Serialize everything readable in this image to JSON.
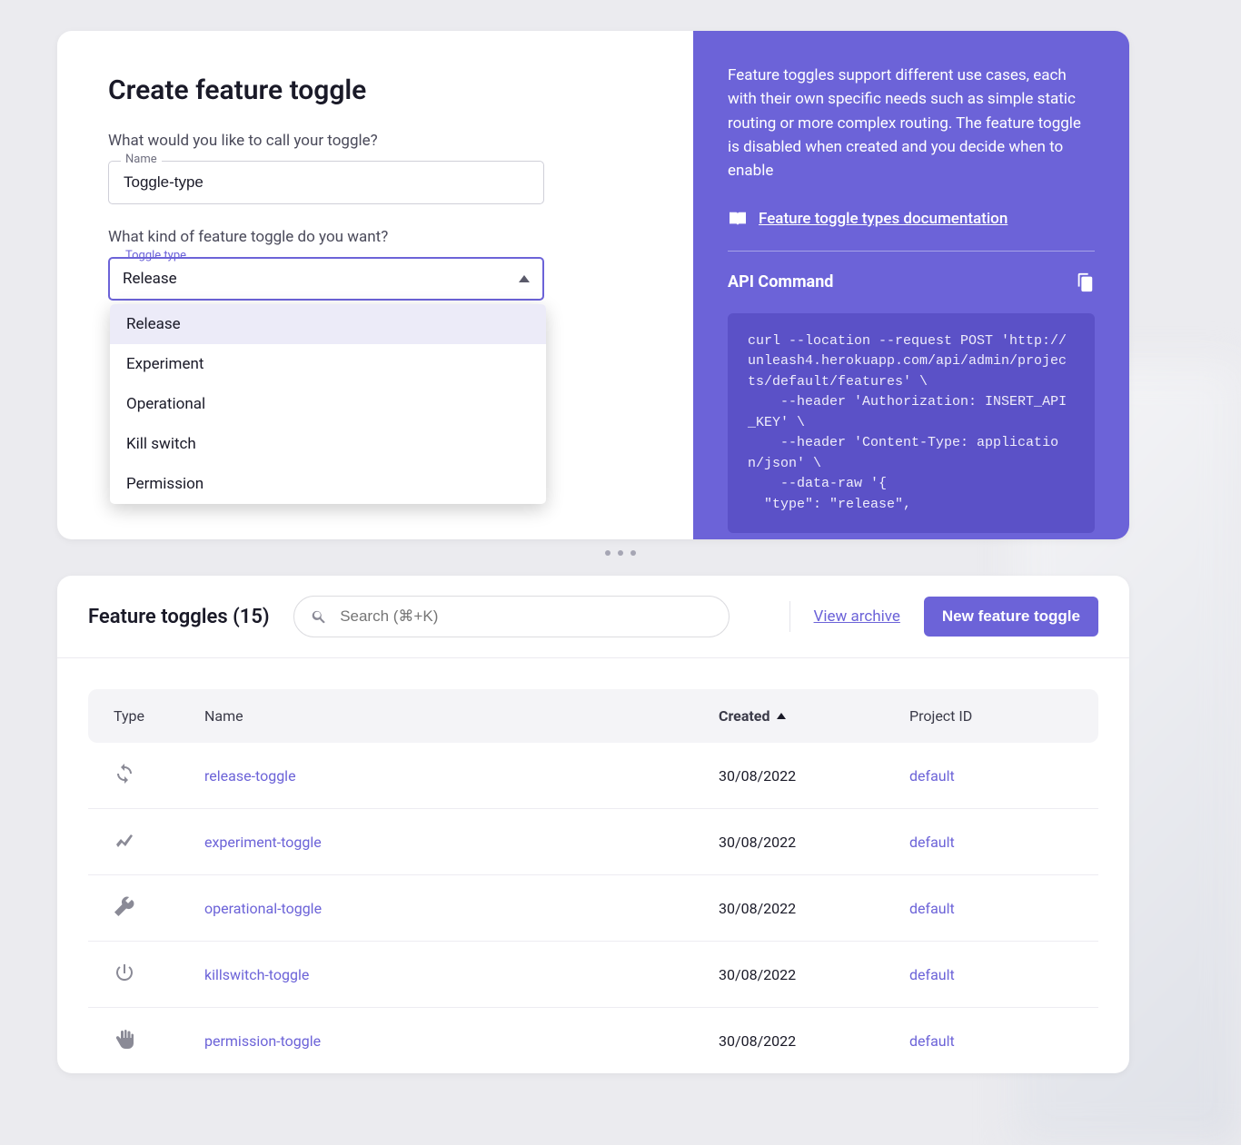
{
  "form": {
    "title": "Create feature toggle",
    "name_question": "What would you like to call your toggle?",
    "name_label": "Name",
    "name_value": "Toggle-type",
    "type_question": "What kind of feature toggle do you want?",
    "type_label": "Toggle type",
    "type_value": "Release",
    "type_options": [
      {
        "label": "Release",
        "selected": true
      },
      {
        "label": "Experiment",
        "selected": false
      },
      {
        "label": "Operational",
        "selected": false
      },
      {
        "label": "Kill switch",
        "selected": false
      },
      {
        "label": "Permission",
        "selected": false
      }
    ]
  },
  "info": {
    "description": "Feature toggles support different use cases, each with their own specific needs such as simple static routing or more complex routing. The feature toggle is disabled when created and you decide when to enable",
    "doc_link_label": "Feature toggle types documentation",
    "api_title": "API Command",
    "api_code": "curl --location --request POST 'http://unleash4.herokuapp.com/api/admin/projects/default/features' \\\n    --header 'Authorization: INSERT_API_KEY' \\\n    --header 'Content-Type: application/json' \\\n    --data-raw '{\n  \"type\": \"release\","
  },
  "list": {
    "title": "Feature toggles (15)",
    "search_placeholder": "Search (⌘+K)",
    "archive_link": "View archive",
    "new_button": "New feature toggle",
    "columns": {
      "type": "Type",
      "name": "Name",
      "created": "Created",
      "project": "Project ID"
    },
    "rows": [
      {
        "icon": "sync-icon",
        "name": "release-toggle",
        "created": "30/08/2022",
        "project": "default"
      },
      {
        "icon": "chart-icon",
        "name": "experiment-toggle",
        "created": "30/08/2022",
        "project": "default"
      },
      {
        "icon": "wrench-icon",
        "name": "operational-toggle",
        "created": "30/08/2022",
        "project": "default"
      },
      {
        "icon": "power-icon",
        "name": "killswitch-toggle",
        "created": "30/08/2022",
        "project": "default"
      },
      {
        "icon": "hand-icon",
        "name": "permission-toggle",
        "created": "30/08/2022",
        "project": "default"
      }
    ]
  }
}
